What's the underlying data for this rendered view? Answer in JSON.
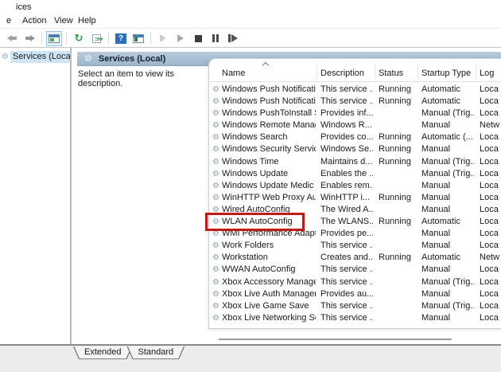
{
  "window": {
    "title_partial": "ices"
  },
  "menu": {
    "items": [
      "e",
      "Action",
      "View",
      "Help"
    ]
  },
  "toolbar": {
    "buttons": [
      "back",
      "forward",
      "console-window",
      "refresh",
      "export-list",
      "help",
      "show-console-tree",
      "start-service",
      "resume-service",
      "stop-service",
      "pause-service",
      "restart-service"
    ]
  },
  "icons": {
    "gear_glyph": "⚙",
    "refresh_glyph": "↻",
    "export_arrow_glyph": "→",
    "help_glyph": "?"
  },
  "tree": {
    "selected_item": "Services (Local)"
  },
  "main": {
    "header_title": "Services (Local)",
    "description_hint": "Select an item to view its description.",
    "table": {
      "columns": [
        "Name",
        "Description",
        "Status",
        "Startup Type",
        "Log"
      ],
      "rows": [
        {
          "name": "Windows Push Notification...",
          "description": "This service ...",
          "status": "Running",
          "startup_type": "Automatic",
          "log_on_as": "Loca"
        },
        {
          "name": "Windows Push Notification...",
          "description": "This service ...",
          "status": "Running",
          "startup_type": "Automatic",
          "log_on_as": "Loca"
        },
        {
          "name": "Windows PushToInstall Serv...",
          "description": "Provides inf...",
          "status": "",
          "startup_type": "Manual (Trig...",
          "log_on_as": "Loca"
        },
        {
          "name": "Windows Remote Manage...",
          "description": "Windows R...",
          "status": "",
          "startup_type": "Manual",
          "log_on_as": "Netw"
        },
        {
          "name": "Windows Search",
          "description": "Provides co...",
          "status": "Running",
          "startup_type": "Automatic (...",
          "log_on_as": "Loca"
        },
        {
          "name": "Windows Security Service",
          "description": "Windows Se...",
          "status": "Running",
          "startup_type": "Manual",
          "log_on_as": "Loca"
        },
        {
          "name": "Windows Time",
          "description": "Maintains d...",
          "status": "Running",
          "startup_type": "Manual (Trig...",
          "log_on_as": "Loca"
        },
        {
          "name": "Windows Update",
          "description": "Enables the ...",
          "status": "",
          "startup_type": "Manual (Trig...",
          "log_on_as": "Loca"
        },
        {
          "name": "Windows Update Medic Ser...",
          "description": "Enables rem...",
          "status": "",
          "startup_type": "Manual",
          "log_on_as": "Loca"
        },
        {
          "name": "WinHTTP Web Proxy Auto-...",
          "description": "WinHTTP i...",
          "status": "Running",
          "startup_type": "Manual",
          "log_on_as": "Loca"
        },
        {
          "name": "Wired AutoConfig",
          "description": "The Wired A...",
          "status": "",
          "startup_type": "Manual",
          "log_on_as": "Loca"
        },
        {
          "name": "WLAN AutoConfig",
          "description": "The WLANS...",
          "status": "Running",
          "startup_type": "Automatic",
          "log_on_as": "Loca",
          "highlighted": true
        },
        {
          "name": "WMI Performance Adapter",
          "description": "Provides pe...",
          "status": "",
          "startup_type": "Manual",
          "log_on_as": "Loca"
        },
        {
          "name": "Work Folders",
          "description": "This service ...",
          "status": "",
          "startup_type": "Manual",
          "log_on_as": "Loca"
        },
        {
          "name": "Workstation",
          "description": "Creates and...",
          "status": "Running",
          "startup_type": "Automatic",
          "log_on_as": "Netw"
        },
        {
          "name": "WWAN AutoConfig",
          "description": "This service ...",
          "status": "",
          "startup_type": "Manual",
          "log_on_as": "Loca"
        },
        {
          "name": "Xbox Accessory Manageme...",
          "description": "This service ...",
          "status": "",
          "startup_type": "Manual (Trig...",
          "log_on_as": "Loca"
        },
        {
          "name": "Xbox Live Auth Manager",
          "description": "Provides au...",
          "status": "",
          "startup_type": "Manual",
          "log_on_as": "Loca"
        },
        {
          "name": "Xbox Live Game Save",
          "description": "This service ...",
          "status": "",
          "startup_type": "Manual (Trig...",
          "log_on_as": "Loca"
        },
        {
          "name": "Xbox Live Networking Service",
          "description": "This service ...",
          "status": "",
          "startup_type": "Manual",
          "log_on_as": "Loca"
        }
      ]
    },
    "tabs": [
      "Extended",
      "Standard"
    ]
  },
  "colors": {
    "header_bar_top": "#b9cbdc",
    "header_bar_bottom": "#9cb4ca",
    "tree_selection": "#cde5f7",
    "highlight_red": "#c11b17",
    "toolbar_active_bg": "#e4f1fb",
    "footer_gray": "#ececec"
  }
}
